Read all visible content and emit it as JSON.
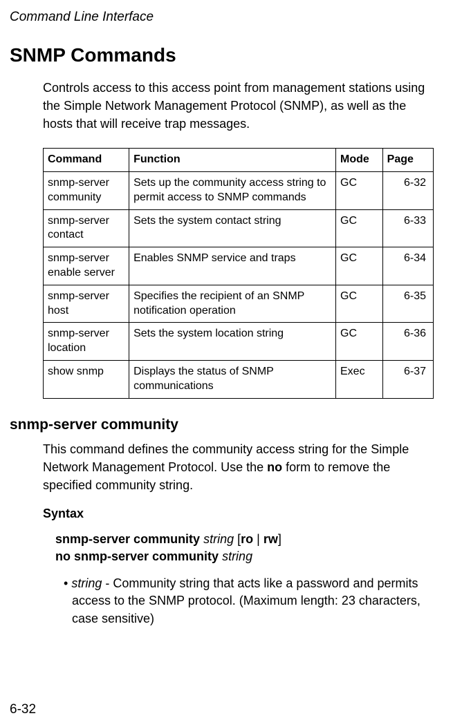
{
  "page": {
    "header": "Command Line Interface",
    "number": "6-32"
  },
  "main": {
    "title": "SNMP Commands",
    "intro": "Controls access to this access point from management stations using the Simple Network Management Protocol (SNMP), as well as the hosts that will receive trap messages."
  },
  "table": {
    "headers": {
      "command": "Command",
      "function": "Function",
      "mode": "Mode",
      "page": "Page"
    },
    "rows": [
      {
        "command": "snmp-server community",
        "function": "Sets up the community access string to permit access to SNMP commands",
        "mode": "GC",
        "page": "6-32"
      },
      {
        "command": "snmp-server contact",
        "function": "Sets the system contact string",
        "mode": "GC",
        "page": "6-33"
      },
      {
        "command": "snmp-server enable server",
        "function": "Enables SNMP service and traps",
        "mode": "GC",
        "page": "6-34"
      },
      {
        "command": "snmp-server host",
        "function": "Specifies the recipient of an SNMP notification operation",
        "mode": "GC",
        "page": "6-35"
      },
      {
        "command": "snmp-server location",
        "function": "Sets the system location string",
        "mode": "GC",
        "page": "6-36"
      },
      {
        "command": "show snmp",
        "function": "Displays the status of SNMP communications",
        "mode": "Exec",
        "page": "6-37"
      }
    ]
  },
  "section": {
    "title": "snmp-server community",
    "desc_part1": "This command defines the community access string for the Simple Network Management Protocol. Use the ",
    "desc_bold": "no",
    "desc_part2": " form to remove the specified community string.",
    "syntax_heading": "Syntax",
    "syntax": {
      "line1_bold1": "snmp-server community ",
      "line1_italic1": "string",
      "line1_space": " ",
      "line1_bracket_open": "[",
      "line1_bold2": "ro",
      "line1_pipe": " | ",
      "line1_bold3": "rw",
      "line1_bracket_close": "]",
      "line2_bold": "no snmp-server community ",
      "line2_italic": "string"
    },
    "bullet": {
      "marker": "•",
      "italic": "string",
      "rest": " - Community string that acts like a password and permits access to the SNMP protocol. (Maximum length: 23 characters, case sensitive)"
    }
  }
}
